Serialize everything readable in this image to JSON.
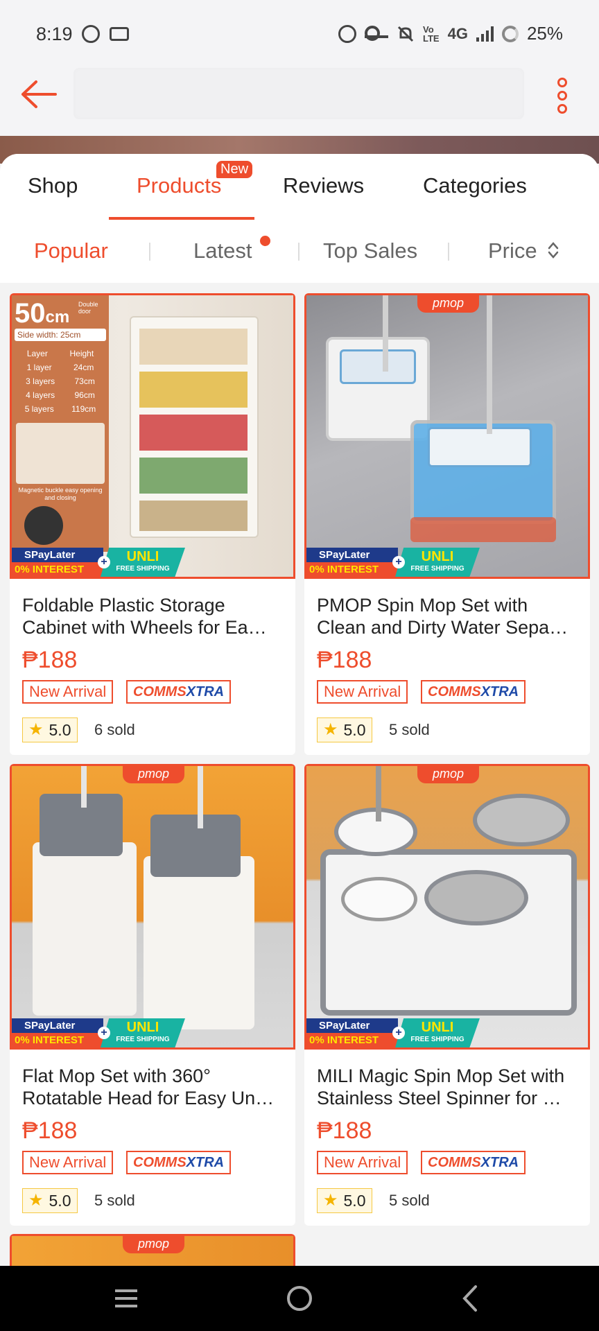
{
  "status": {
    "time": "8:19",
    "net": "4G",
    "volte_top": "Vo",
    "volte_bottom": "LTE",
    "battery": "25%"
  },
  "tabs": [
    {
      "label": "Shop"
    },
    {
      "label": "Products",
      "badge": "New"
    },
    {
      "label": "Reviews"
    },
    {
      "label": "Categories"
    }
  ],
  "sort": [
    {
      "label": "Popular"
    },
    {
      "label": "Latest"
    },
    {
      "label": "Top Sales"
    },
    {
      "label": "Price"
    }
  ],
  "promo": {
    "spaylater": "SPayLater",
    "interest": "0% INTEREST",
    "unli": "UNLI",
    "free_ship": "FREE SHIPPING"
  },
  "image_text": {
    "size": "50",
    "unit": "cm",
    "door": "Double door",
    "side": "Side width: 25cm",
    "col_layer": "Layer",
    "col_height": "Height",
    "rows": [
      [
        "1 layer",
        "24cm"
      ],
      [
        "3 layers",
        "73cm"
      ],
      [
        "4 layers",
        "96cm"
      ],
      [
        "5 layers",
        "119cm"
      ]
    ],
    "magnetic": "Magnetic buckle easy opening and closing",
    "brand": "pmop"
  },
  "products": [
    {
      "title": "Foldable Plastic Storage Cabinet with Wheels for Ea…",
      "price": "₱188",
      "tag": "New Arrival",
      "brand_a": "COMMS",
      "brand_b": "XTRA",
      "rating": "5.0",
      "sold": "6 sold"
    },
    {
      "title": "PMOP Spin Mop Set with Clean and Dirty Water Sepa…",
      "price": "₱188",
      "tag": "New Arrival",
      "brand_a": "COMMS",
      "brand_b": "XTRA",
      "rating": "5.0",
      "sold": "5 sold"
    },
    {
      "title": "Flat Mop Set with 360° Rotatable Head for Easy Un…",
      "price": "₱188",
      "tag": "New Arrival",
      "brand_a": "COMMS",
      "brand_b": "XTRA",
      "rating": "5.0",
      "sold": "5 sold"
    },
    {
      "title": "MILI Magic Spin Mop Set with Stainless Steel Spinner for …",
      "price": "₱188",
      "tag": "New Arrival",
      "brand_a": "COMMS",
      "brand_b": "XTRA",
      "rating": "5.0",
      "sold": "5 sold"
    }
  ],
  "colors": {
    "accent": "#ee4d2d",
    "rating_bg": "#fff8e1",
    "star": "#f5b400"
  }
}
